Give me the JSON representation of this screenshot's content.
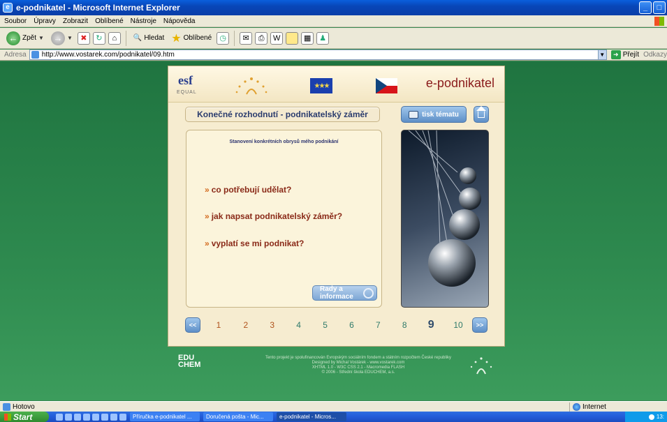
{
  "window": {
    "title": "e-podnikatel - Microsoft Internet Explorer",
    "minimize": "_",
    "maximize": "□"
  },
  "menu": [
    "Soubor",
    "Úpravy",
    "Zobrazit",
    "Oblíbené",
    "Nástroje",
    "Nápověda"
  ],
  "toolbar": {
    "back_label": "Zpět",
    "search_label": "Hledat",
    "favorites_label": "Oblíbené"
  },
  "address": {
    "label": "Adresa",
    "url": "http://www.vostarek.com/podnikatel/09.htm",
    "go_label": "Přejít",
    "links_label": "Odkazy"
  },
  "site": {
    "esf_logo": "esf",
    "equal_label": "EQUAL",
    "brand": "e-podnikatel",
    "topic_title": "Konečné rozhodnutí - podnikatelský záměr",
    "print_label": "tisk tématu",
    "panel_subtitle": "Stanovení konkrétních obrysů mého podnikání",
    "questions": [
      "co potřebují udělat?",
      "jak napsat podnikatelský záměr?",
      "vyplatí se mi podnikat?"
    ],
    "question_marker": "»",
    "rady_label": "Rady a informace",
    "pager": {
      "prev": "<<",
      "next": ">>",
      "pages": [
        "1",
        "2",
        "3",
        "4",
        "5",
        "6",
        "7",
        "8",
        "9",
        "10"
      ],
      "active_page": "9"
    }
  },
  "footer": {
    "logo_line1": "EDU",
    "logo_line2": "CHEM",
    "line1": "Tento projekt je spolufinancován Evropským sociálním fondem a státním rozpočtem České republiky",
    "line2": "Designed by Michal Vostárek - www.vostarek.com",
    "line3": "XHTML 1.0 - W3C CSS 2.1 - Macromedia FLASH",
    "line4": "© 2006 - Střední škola EDUCHEM, a.s."
  },
  "status": {
    "text": "Hotovo",
    "zone": "Internet"
  },
  "taskbar": {
    "start": "Start",
    "tasks": [
      "Příručka e-podnikatel ...",
      "Doručená pošta - Mic...",
      "e-podnikatel - Micros..."
    ],
    "clock": "13:"
  },
  "colors": {
    "desktop_green": "#2e8a4f",
    "question_red": "#8a2a18",
    "button_blue": "#5e8fc7",
    "page_number_orange": "#b0521c"
  }
}
